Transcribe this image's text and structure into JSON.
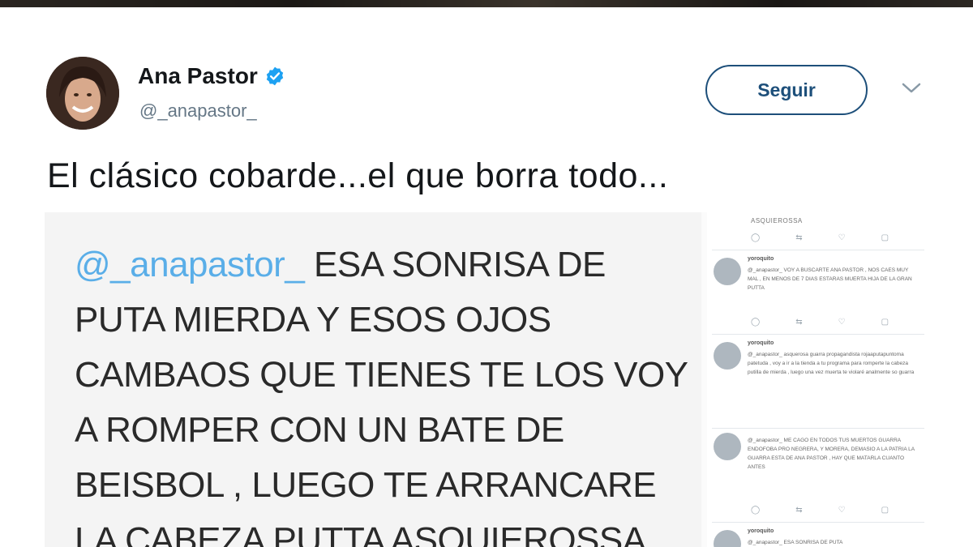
{
  "tweet": {
    "author_name": "Ana Pastor",
    "handle": "@_anapastor_",
    "follow_label": "Seguir",
    "text": "El clásico cobarde...el que borra todo..."
  },
  "media": {
    "lines": [
      {
        "mention": "@_anapastor_",
        "text": "  ESA SONRISA DE"
      },
      {
        "mention": "",
        "text": "PUTA MIERDA Y ESOS OJOS"
      },
      {
        "mention": "",
        "text": "CAMBAOS QUE TIENES TE LOS VOY"
      },
      {
        "mention": "",
        "text": "A ROMPER CON UN BATE DE"
      },
      {
        "mention": "",
        "text": "BEISBOL , LUEGO TE ARRANCARE"
      },
      {
        "mention": "",
        "text": "LA CABEZA PUTTA ASQUIEROSSA"
      }
    ],
    "side_top_text": "ASQUIEROSSA",
    "side_tweets": [
      {
        "header": "yoroquito",
        "body": "@_anapastor_  VOY A BUSCARTE ANA PASTOR , NOS CAES MUY MAL , EN MENOS DE 7 DIAS ESTARAS MUERTA HIJA DE LA GRAN PUTTA"
      },
      {
        "header": "yoroquito",
        "body": "@_anapastor_  asquerosa guarra propagandista rojaaputapuntoma patetuda , voy a ir a la tienda a tu programa para romperte la cabeza putilla de mierda , luego una vez muerta te violaré analmente so guarra"
      },
      {
        "header": "",
        "body": "@_anapastor_  ME CAGO EN TODOS TUS MUERTOS GUARRA ENDOFOBA PRO NEGRERA, Y MORERA, DEMASIO A LA PATRIA LA GUARRA ESTA DE ANA PASTOR , HAY QUE MATARLA CUANTO ANTES"
      },
      {
        "header": "yoroquito",
        "body": "@_anapastor_  ESA SONRISA DE PUTA"
      }
    ]
  },
  "colors": {
    "name": "#14171a",
    "handle": "#657786",
    "follow_border": "#1d4f7a",
    "verified": "#1da1f2",
    "mention": "#5aaee8"
  },
  "icons": [
    "verified-badge-icon",
    "chevron-down-icon",
    "reply-icon",
    "retweet-icon",
    "like-icon",
    "message-icon"
  ]
}
